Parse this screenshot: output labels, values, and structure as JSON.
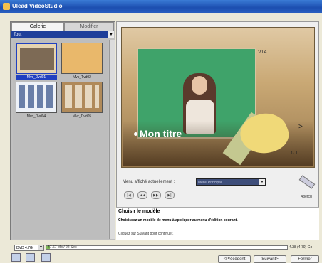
{
  "window": {
    "title": "Ulead VideoStudio"
  },
  "tabs": [
    {
      "label": "Galerie"
    },
    {
      "label": "Modifier"
    }
  ],
  "gallery": {
    "filter": "Tout",
    "thumbnails": [
      {
        "label": "Mvc_Dvd01"
      },
      {
        "label": "Mvc_Tvd02"
      },
      {
        "label": "Mvc_Dvd04"
      },
      {
        "label": "Mvc_Dvd05"
      }
    ]
  },
  "preview": {
    "menu_title": "Mon titre",
    "template_code": "V14",
    "next_arrow": ">",
    "page_counter": "1/ 1"
  },
  "menu_selector": {
    "label": "Menu affiché actuellement :",
    "selected": "Menu Principal"
  },
  "playback": {
    "buttons": [
      "|◀",
      "◀◀",
      "▶▶",
      "▶|"
    ]
  },
  "apercu": {
    "label": "Aperçu"
  },
  "info": {
    "title": "Choisir le modèle",
    "description": "Choisissez un modèle de menu à appliquer au menu d'édition courant.",
    "hint": "Cliquez sur Suivant pour continuer."
  },
  "status": {
    "disc_type": "DVD 4.7G",
    "usage_text": "47.67 Mo / 22 Sec",
    "capacity_text": "4.38 (4.70) Go",
    "usage_fraction": 0.015
  },
  "buttons": {
    "previous": "<Précédent",
    "next": "Suivant>",
    "close": "Fermer"
  },
  "colors": {
    "title_bar": "#1c4fb0",
    "preview_background": "#3fa36a"
  }
}
